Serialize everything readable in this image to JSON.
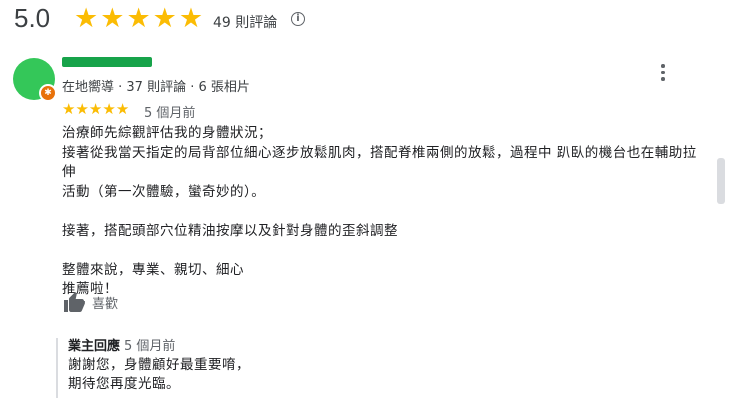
{
  "summary": {
    "rating": "5.0",
    "stars": [
      "★",
      "★",
      "★",
      "★",
      "★"
    ],
    "review_count": "49 則評論",
    "info_icon": "i"
  },
  "review": {
    "reviewer_meta": "在地嚮導 · 37 則評論 · 6 張相片",
    "badge_icon": "✱",
    "stars": [
      "★",
      "★",
      "★",
      "★",
      "★"
    ],
    "date": "5 個月前",
    "lines": {
      "l1": "治療師先綜觀評估我的身體狀況；",
      "l2": "接著從我當天指定的局背部位細心逐步放鬆肌肉，搭配脊椎兩側的放鬆，過程中 趴臥的機台也在輔助拉伸",
      "l3": "活動（第一次體驗，蠻奇妙的）。",
      "l4": "接著，搭配頭部穴位精油按摩以及針對身體的歪斜調整",
      "l5": "整體來說，專業、親切、細心",
      "l6": "推薦啦！"
    },
    "like_label": "喜歡"
  },
  "reply": {
    "owner_label": "業主回應",
    "date": "5 個月前",
    "line1": "謝謝您，身體顧好最重要唷，",
    "line2": "期待您再度光臨。"
  },
  "colors": {
    "star": "#fbbc04",
    "avatar": "#34c759",
    "badge": "#e8710a"
  }
}
